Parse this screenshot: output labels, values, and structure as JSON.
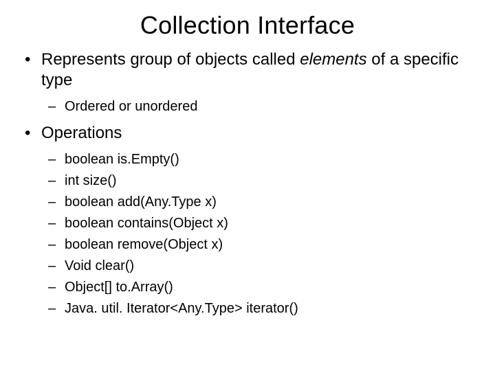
{
  "title": "Collection Interface",
  "bullet1": {
    "pre": "Represents group of objects called ",
    "em": "elements",
    "post": " of a specific type",
    "sub": [
      "Ordered or unordered"
    ]
  },
  "bullet2": {
    "label": "Operations",
    "sub": [
      "boolean is.Empty()",
      "int size()",
      "boolean add(Any.Type x)",
      "boolean contains(Object x)",
      "boolean remove(Object x)",
      "Void clear()",
      "Object[] to.Array()",
      "Java. util. Iterator<Any.Type> iterator()"
    ]
  }
}
